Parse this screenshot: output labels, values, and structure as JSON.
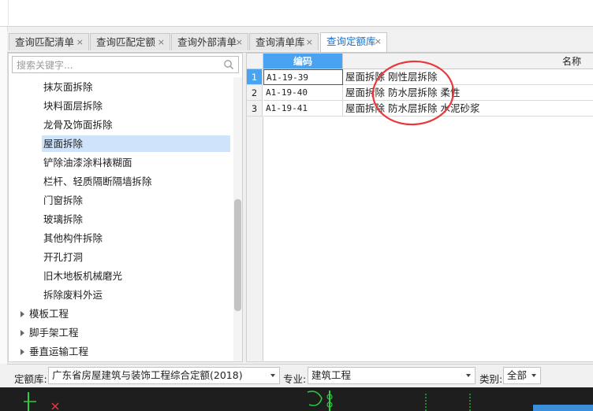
{
  "tabs": [
    {
      "label": "查询匹配清单",
      "close": "×",
      "active": false
    },
    {
      "label": "查询匹配定额",
      "close": "×",
      "active": false
    },
    {
      "label": "查询外部清单",
      "close": "×",
      "active": false
    },
    {
      "label": "查询清单库",
      "close": "×",
      "active": false
    },
    {
      "label": "查询定额库",
      "close": "×",
      "active": true
    }
  ],
  "search": {
    "placeholder": "搜索关键字..."
  },
  "tree": {
    "items": [
      {
        "label": "抹灰面拆除",
        "level": 2
      },
      {
        "label": "块料面层拆除",
        "level": 2
      },
      {
        "label": "龙骨及饰面拆除",
        "level": 2
      },
      {
        "label": "屋面拆除",
        "level": 2,
        "selected": true
      },
      {
        "label": "铲除油漆涂料裱糊面",
        "level": 2
      },
      {
        "label": "栏杆、轻质隔断隔墙拆除",
        "level": 2
      },
      {
        "label": "门窗拆除",
        "level": 2
      },
      {
        "label": "玻璃拆除",
        "level": 2
      },
      {
        "label": "其他构件拆除",
        "level": 2
      },
      {
        "label": "开孔打洞",
        "level": 2
      },
      {
        "label": "旧木地板机械磨光",
        "level": 2
      },
      {
        "label": "拆除废料外运",
        "level": 2
      },
      {
        "label": "模板工程",
        "level": 1,
        "collapsed": true
      },
      {
        "label": "脚手架工程",
        "level": 1,
        "collapsed": true
      },
      {
        "label": "垂直运输工程",
        "level": 1,
        "collapsed": true
      }
    ]
  },
  "table": {
    "columns": {
      "code": "编码",
      "name": "名称"
    },
    "rows": [
      {
        "num": "1",
        "code": "A1-19-39",
        "name": "屋面拆除 刚性层拆除"
      },
      {
        "num": "2",
        "code": "A1-19-40",
        "name": "屋面拆除 防水层拆除 柔性"
      },
      {
        "num": "3",
        "code": "A1-19-41",
        "name": "屋面拆除 防水层拆除 水泥砂浆"
      }
    ]
  },
  "bottom": {
    "quota_label": "定额库:",
    "quota_value": "广东省房屋建筑与装饰工程综合定额(2018)",
    "major_label": "专业:",
    "major_value": "建筑工程",
    "category_label": "类别:",
    "category_value": "全部"
  },
  "colors": {
    "accent": "#4aa3f0",
    "selection": "#cfe3fa",
    "annotation": "#e8383d"
  }
}
